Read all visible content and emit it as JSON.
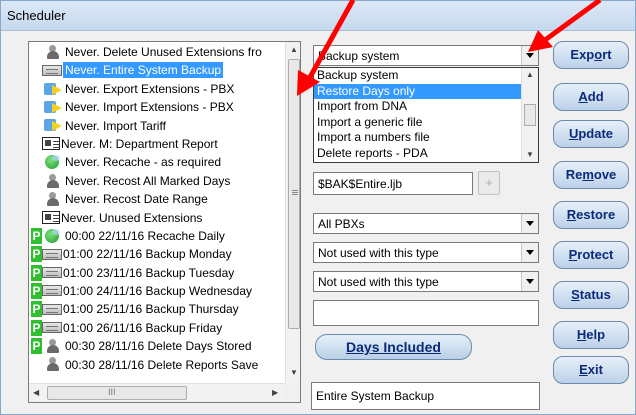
{
  "window": {
    "title": "Scheduler"
  },
  "list": {
    "rows": [
      {
        "p": "",
        "icon": "user",
        "text": "Never.  Delete Unused Extensions fro",
        "selected": false
      },
      {
        "p": "",
        "icon": "tape",
        "text": "Never.  Entire System Backup",
        "selected": true
      },
      {
        "p": "",
        "icon": "arrow",
        "text": "Never.  Export Extensions - PBX",
        "selected": false
      },
      {
        "p": "",
        "icon": "arrow",
        "text": "Never.  Import Extensions - PBX",
        "selected": false
      },
      {
        "p": "",
        "icon": "arrow",
        "text": "Never.  Import Tariff",
        "selected": false
      },
      {
        "p": "",
        "icon": "doc",
        "text": "Never.  M: Department Report",
        "selected": false
      },
      {
        "p": "",
        "icon": "globe",
        "text": "Never.  Recache - as required",
        "selected": false
      },
      {
        "p": "",
        "icon": "user",
        "text": "Never.  Recost All Marked Days",
        "selected": false
      },
      {
        "p": "",
        "icon": "user",
        "text": "Never.  Recost Date Range",
        "selected": false
      },
      {
        "p": "",
        "icon": "doc",
        "text": "Never.  Unused Extensions",
        "selected": false
      },
      {
        "p": "P",
        "icon": "globe",
        "text": "00:00 22/11/16 Recache Daily",
        "selected": false
      },
      {
        "p": "P",
        "icon": "tape",
        "text": "01:00 22/11/16 Backup Monday",
        "selected": false
      },
      {
        "p": "P",
        "icon": "tape",
        "text": "01:00 23/11/16 Backup Tuesday",
        "selected": false
      },
      {
        "p": "P",
        "icon": "tape",
        "text": "01:00 24/11/16 Backup Wednesday",
        "selected": false
      },
      {
        "p": "P",
        "icon": "tape",
        "text": "01:00 25/11/16 Backup Thursday",
        "selected": false
      },
      {
        "p": "P",
        "icon": "tape",
        "text": "01:00 26/11/16 Backup Friday",
        "selected": false
      },
      {
        "p": "P",
        "icon": "user",
        "text": "00:30 28/11/16 Delete Days Stored",
        "selected": false
      },
      {
        "p": "",
        "icon": "user",
        "text": "00:30 28/11/16 Delete Reports Save",
        "selected": false
      }
    ],
    "hscroll_grip": "III"
  },
  "type_combo": {
    "value": "Backup system",
    "options": [
      "Backup system",
      "Restore Days only",
      "Import from DNA",
      "Import a generic file",
      "Import a numbers file",
      "Delete reports - PDA"
    ],
    "highlighted_index": 1
  },
  "filename_field": {
    "value": "$BAK$Entire.ljb",
    "plus_label": "+"
  },
  "pbx_combo": {
    "value": "All PBXs"
  },
  "combo3": {
    "value": "Not used with this type"
  },
  "combo4": {
    "value": "Not used with this type"
  },
  "blank_field": {
    "value": ""
  },
  "days_button": {
    "label": "Days Included"
  },
  "description_field": {
    "value": "Entire System Backup"
  },
  "buttons": [
    {
      "pre": "Exp",
      "key": "o",
      "post": "rt"
    },
    {
      "pre": "",
      "key": "A",
      "post": "dd"
    },
    {
      "pre": "",
      "key": "U",
      "post": "pdate"
    },
    {
      "pre": "Re",
      "key": "m",
      "post": "ove"
    },
    {
      "pre": "",
      "key": "R",
      "post": "estore"
    },
    {
      "pre": "",
      "key": "P",
      "post": "rotect"
    },
    {
      "pre": "",
      "key": "S",
      "post": "tatus"
    },
    {
      "pre": "",
      "key": "H",
      "post": "elp"
    },
    {
      "pre": "",
      "key": "E",
      "post": "xit"
    }
  ],
  "colors": {
    "selection": "#3399ff",
    "annotation": "#ff0000",
    "button_text": "#0b2a7a",
    "p_badge": "#2fbf2f"
  }
}
